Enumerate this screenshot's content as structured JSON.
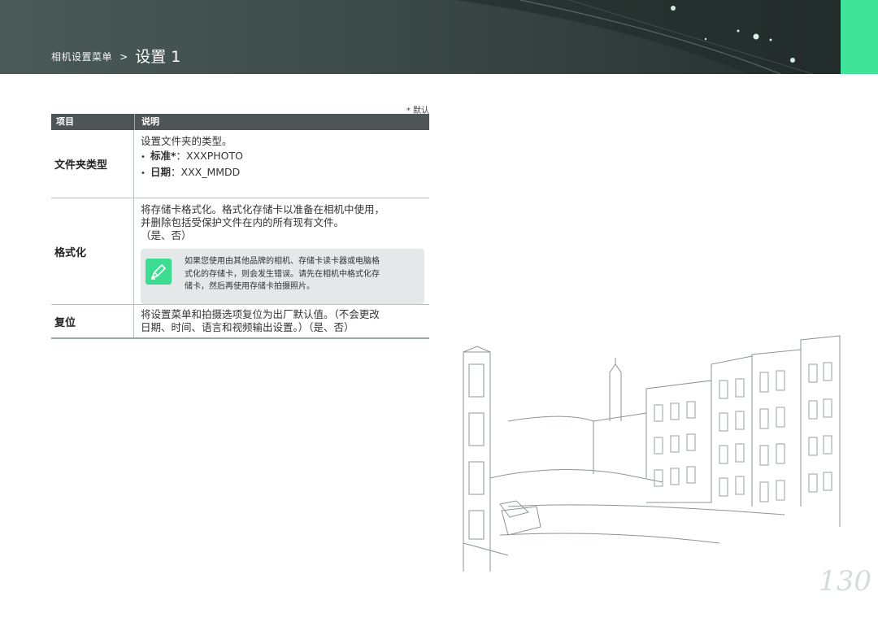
{
  "header": {
    "section": "相机设置菜单",
    "separator": ">",
    "page_title": "设置 1"
  },
  "colors": {
    "banner": "#3c4a47",
    "accent": "#3fe39a",
    "table_header": "#4f5557",
    "note_bg": "#e4e8e8"
  },
  "table": {
    "default_note": "* 默认",
    "headers": {
      "item": "项目",
      "description": "说明"
    },
    "rows": [
      {
        "label": "文件夹类型",
        "intro": "设置文件夹的类型。",
        "options": [
          {
            "label": "标准*",
            "value": "：XXXPHOTO"
          },
          {
            "label": "日期",
            "value": "：XXX_MMDD"
          }
        ]
      },
      {
        "label": "格式化",
        "lines": [
          "将存储卡格式化。格式化存储卡以准备在相机中使用，",
          "并删除包括受保护文件在内的所有现有文件。",
          "（是、否）"
        ],
        "note": {
          "icon": "pencil-note-icon",
          "lines": [
            "如果您使用由其他品牌的相机、存储卡读卡器或电脑格",
            "式化的存储卡，则会发生错误。请先在相机中格式化存",
            "储卡，然后再使用存储卡拍摄照片。"
          ]
        }
      },
      {
        "label": "复位",
        "lines": [
          "将设置菜单和拍摄选项复位为出厂默认值。（不会更改",
          "日期、时间、语言和视频输出设置。）（是、否）"
        ]
      }
    ]
  },
  "page_number": "130"
}
